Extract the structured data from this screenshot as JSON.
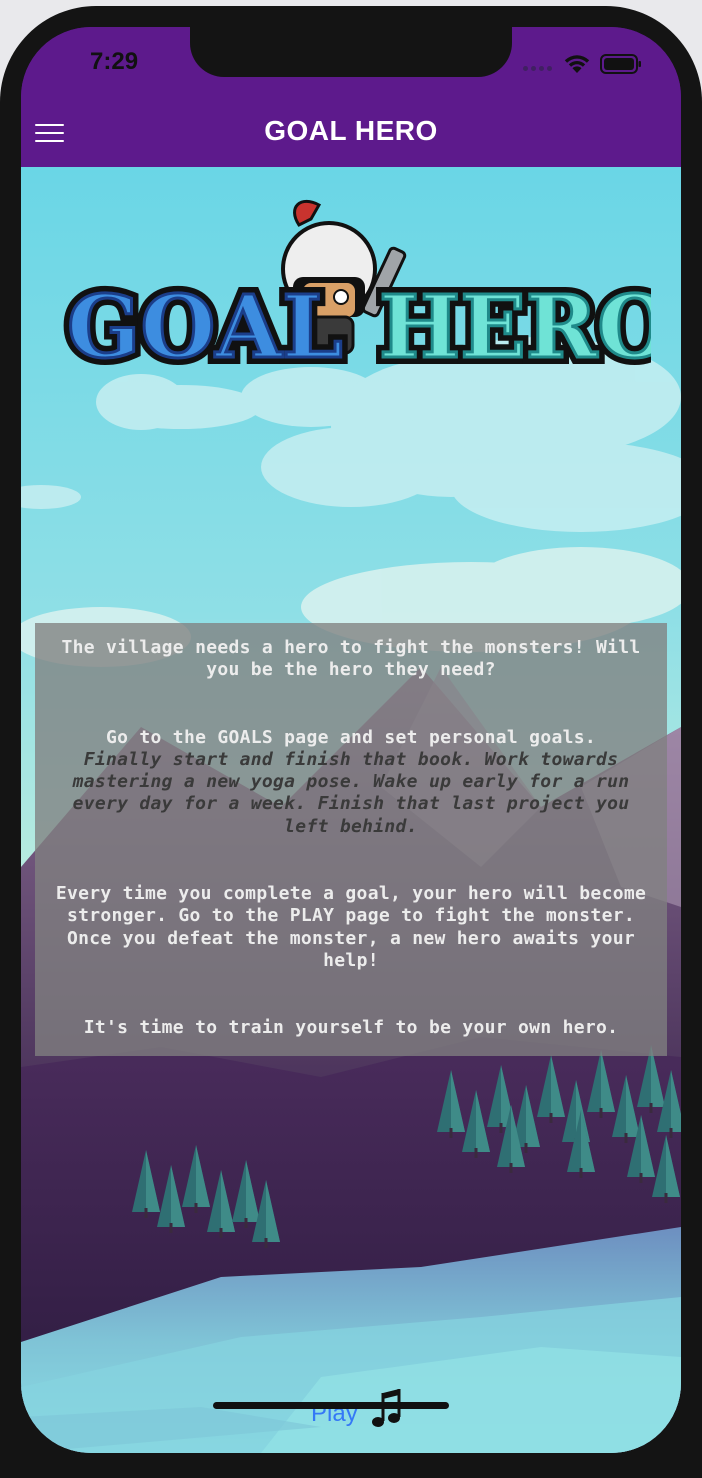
{
  "status_bar": {
    "time": "7:29"
  },
  "header": {
    "title": "GOAL HERO",
    "menu_icon": "hamburger-menu-icon"
  },
  "logo": {
    "text_left": "GOAL",
    "text_right": "HERO"
  },
  "story": {
    "intro": "The village needs a hero to fight the monsters! Will you be the hero they need?",
    "goals_line": "Go to the GOALS page and set personal goals.",
    "examples": "Finally start and finish that book. Work towards mastering a new yoga pose. Wake up early for a run every day for a week. Finish that last project you left behind.",
    "progress": "Every time you complete a goal, your hero will become stronger. Go to the PLAY page to fight the monster. Once you defeat the monster, a new hero awaits your help!",
    "closing": "It's time to train yourself to be your own hero."
  },
  "footer": {
    "play_label": "Play",
    "music_icon": "music-note-icon"
  },
  "colors": {
    "header_bg": "#5d1a8c",
    "link": "#3478f6"
  }
}
